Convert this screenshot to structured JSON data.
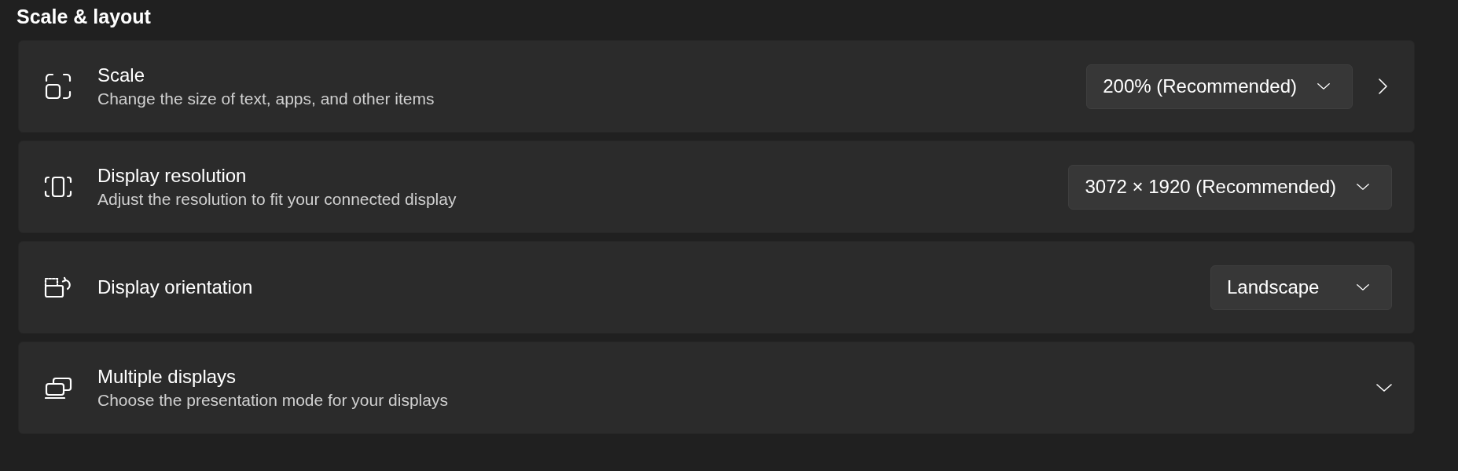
{
  "section": {
    "title": "Scale & layout"
  },
  "settings": [
    {
      "kind": "dropdown",
      "title": "Scale",
      "description": "Change the size of text, apps, and other items",
      "value": "200% (Recommended)",
      "navigable": true
    },
    {
      "kind": "dropdown",
      "title": "Display resolution",
      "description": "Adjust the resolution to fit your connected display",
      "value": "3072 × 1920 (Recommended)",
      "navigable": false
    },
    {
      "kind": "dropdown",
      "title": "Display orientation",
      "value": "Landscape",
      "navigable": false
    },
    {
      "kind": "expander",
      "title": "Multiple displays",
      "description": "Choose the presentation mode for your displays",
      "expanded": false
    }
  ]
}
